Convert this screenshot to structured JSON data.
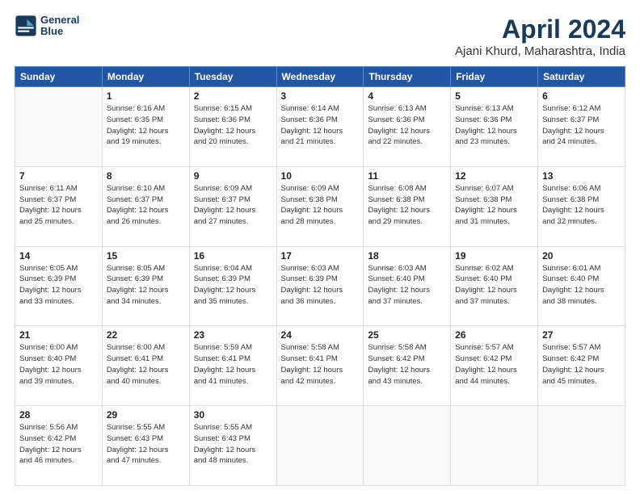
{
  "header": {
    "logo_line1": "General",
    "logo_line2": "Blue",
    "month": "April 2024",
    "location": "Ajani Khurd, Maharashtra, India"
  },
  "weekdays": [
    "Sunday",
    "Monday",
    "Tuesday",
    "Wednesday",
    "Thursday",
    "Friday",
    "Saturday"
  ],
  "weeks": [
    [
      {
        "day": "",
        "text": ""
      },
      {
        "day": "1",
        "text": "Sunrise: 6:16 AM\nSunset: 6:35 PM\nDaylight: 12 hours\nand 19 minutes."
      },
      {
        "day": "2",
        "text": "Sunrise: 6:15 AM\nSunset: 6:36 PM\nDaylight: 12 hours\nand 20 minutes."
      },
      {
        "day": "3",
        "text": "Sunrise: 6:14 AM\nSunset: 6:36 PM\nDaylight: 12 hours\nand 21 minutes."
      },
      {
        "day": "4",
        "text": "Sunrise: 6:13 AM\nSunset: 6:36 PM\nDaylight: 12 hours\nand 22 minutes."
      },
      {
        "day": "5",
        "text": "Sunrise: 6:13 AM\nSunset: 6:36 PM\nDaylight: 12 hours\nand 23 minutes."
      },
      {
        "day": "6",
        "text": "Sunrise: 6:12 AM\nSunset: 6:37 PM\nDaylight: 12 hours\nand 24 minutes."
      }
    ],
    [
      {
        "day": "7",
        "text": "Sunrise: 6:11 AM\nSunset: 6:37 PM\nDaylight: 12 hours\nand 25 minutes."
      },
      {
        "day": "8",
        "text": "Sunrise: 6:10 AM\nSunset: 6:37 PM\nDaylight: 12 hours\nand 26 minutes."
      },
      {
        "day": "9",
        "text": "Sunrise: 6:09 AM\nSunset: 6:37 PM\nDaylight: 12 hours\nand 27 minutes."
      },
      {
        "day": "10",
        "text": "Sunrise: 6:09 AM\nSunset: 6:38 PM\nDaylight: 12 hours\nand 28 minutes."
      },
      {
        "day": "11",
        "text": "Sunrise: 6:08 AM\nSunset: 6:38 PM\nDaylight: 12 hours\nand 29 minutes."
      },
      {
        "day": "12",
        "text": "Sunrise: 6:07 AM\nSunset: 6:38 PM\nDaylight: 12 hours\nand 31 minutes."
      },
      {
        "day": "13",
        "text": "Sunrise: 6:06 AM\nSunset: 6:38 PM\nDaylight: 12 hours\nand 32 minutes."
      }
    ],
    [
      {
        "day": "14",
        "text": "Sunrise: 6:05 AM\nSunset: 6:39 PM\nDaylight: 12 hours\nand 33 minutes."
      },
      {
        "day": "15",
        "text": "Sunrise: 6:05 AM\nSunset: 6:39 PM\nDaylight: 12 hours\nand 34 minutes."
      },
      {
        "day": "16",
        "text": "Sunrise: 6:04 AM\nSunset: 6:39 PM\nDaylight: 12 hours\nand 35 minutes."
      },
      {
        "day": "17",
        "text": "Sunrise: 6:03 AM\nSunset: 6:39 PM\nDaylight: 12 hours\nand 36 minutes."
      },
      {
        "day": "18",
        "text": "Sunrise: 6:03 AM\nSunset: 6:40 PM\nDaylight: 12 hours\nand 37 minutes."
      },
      {
        "day": "19",
        "text": "Sunrise: 6:02 AM\nSunset: 6:40 PM\nDaylight: 12 hours\nand 37 minutes."
      },
      {
        "day": "20",
        "text": "Sunrise: 6:01 AM\nSunset: 6:40 PM\nDaylight: 12 hours\nand 38 minutes."
      }
    ],
    [
      {
        "day": "21",
        "text": "Sunrise: 6:00 AM\nSunset: 6:40 PM\nDaylight: 12 hours\nand 39 minutes."
      },
      {
        "day": "22",
        "text": "Sunrise: 6:00 AM\nSunset: 6:41 PM\nDaylight: 12 hours\nand 40 minutes."
      },
      {
        "day": "23",
        "text": "Sunrise: 5:59 AM\nSunset: 6:41 PM\nDaylight: 12 hours\nand 41 minutes."
      },
      {
        "day": "24",
        "text": "Sunrise: 5:58 AM\nSunset: 6:41 PM\nDaylight: 12 hours\nand 42 minutes."
      },
      {
        "day": "25",
        "text": "Sunrise: 5:58 AM\nSunset: 6:42 PM\nDaylight: 12 hours\nand 43 minutes."
      },
      {
        "day": "26",
        "text": "Sunrise: 5:57 AM\nSunset: 6:42 PM\nDaylight: 12 hours\nand 44 minutes."
      },
      {
        "day": "27",
        "text": "Sunrise: 5:57 AM\nSunset: 6:42 PM\nDaylight: 12 hours\nand 45 minutes."
      }
    ],
    [
      {
        "day": "28",
        "text": "Sunrise: 5:56 AM\nSunset: 6:42 PM\nDaylight: 12 hours\nand 46 minutes."
      },
      {
        "day": "29",
        "text": "Sunrise: 5:55 AM\nSunset: 6:43 PM\nDaylight: 12 hours\nand 47 minutes."
      },
      {
        "day": "30",
        "text": "Sunrise: 5:55 AM\nSunset: 6:43 PM\nDaylight: 12 hours\nand 48 minutes."
      },
      {
        "day": "",
        "text": ""
      },
      {
        "day": "",
        "text": ""
      },
      {
        "day": "",
        "text": ""
      },
      {
        "day": "",
        "text": ""
      }
    ]
  ]
}
